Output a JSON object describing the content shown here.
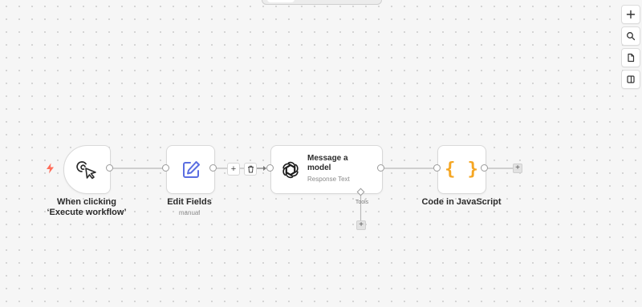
{
  "canvas": {
    "background": "#f6f6f6"
  },
  "toolbar_right": {
    "items": [
      {
        "name": "add-node-button",
        "icon": "plus-icon"
      },
      {
        "name": "search-nodes-button",
        "icon": "search-icon"
      },
      {
        "name": "notes-button",
        "icon": "document-icon"
      },
      {
        "name": "toggle-panel-button",
        "icon": "panel-icon"
      }
    ]
  },
  "nodes": {
    "trigger": {
      "label": "When clicking ‘Execute workflow’",
      "icon": "cursor-click-icon",
      "badge_icon": "lightning-icon",
      "badge_color": "#ff6d5a"
    },
    "edit_fields": {
      "label": "Edit Fields",
      "sublabel": "manual",
      "icon": "pencil-square-icon",
      "icon_color": "#5b6ee1"
    },
    "message_model": {
      "title": "Message a model",
      "subtitle": "Response Text",
      "icon": "openai-icon",
      "tools_label": "Tools"
    },
    "code": {
      "label": "Code in JavaScript",
      "icon": "braces-icon",
      "icon_glyph": "{ }",
      "icon_color": "#f5a623"
    }
  },
  "edge_controls": {
    "add_glyph": "+",
    "delete_icon": "trash-icon"
  },
  "add_buttons": {
    "glyph": "+"
  }
}
